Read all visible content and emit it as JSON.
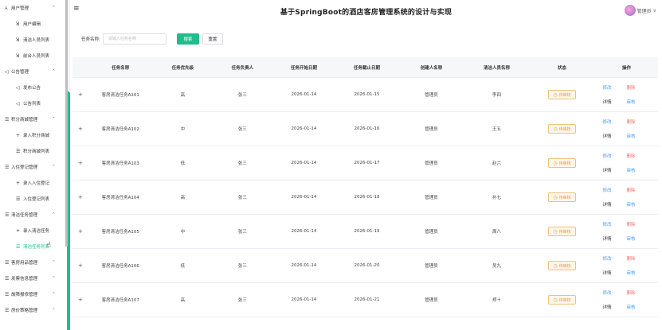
{
  "app": {
    "title": "基于SpringBoot的酒店客房管理系统的设计与实现",
    "user_name": "管理员"
  },
  "sidebar": {
    "groups": [
      {
        "label": "用户管理",
        "icon": "user-group-icon",
        "expanded": true,
        "items": [
          {
            "label": "用户编辑",
            "icon": "person-icon"
          },
          {
            "label": "清洁人员列表",
            "icon": "person-icon"
          },
          {
            "label": "前台人员列表",
            "icon": "person-icon"
          }
        ]
      },
      {
        "label": "公告管理",
        "icon": "speaker-icon",
        "expanded": true,
        "items": [
          {
            "label": "发布公告",
            "icon": "send-icon"
          },
          {
            "label": "公告列表",
            "icon": "speaker-icon"
          }
        ]
      },
      {
        "label": "积分商城管理",
        "icon": "list-icon",
        "expanded": true,
        "items": [
          {
            "label": "录入积分商城",
            "icon": "plus-icon"
          },
          {
            "label": "积分商城列表",
            "icon": "list-icon"
          }
        ]
      },
      {
        "label": "入住登记管理",
        "icon": "list-icon",
        "expanded": true,
        "items": [
          {
            "label": "录入入住登记",
            "icon": "plus-icon"
          },
          {
            "label": "入住登记列表",
            "icon": "list-icon"
          }
        ]
      },
      {
        "label": "清洁任务管理",
        "icon": "list-icon",
        "expanded": true,
        "items": [
          {
            "label": "录入清洁任务",
            "icon": "plus-icon"
          },
          {
            "label": "清洁任务列表",
            "icon": "list-icon",
            "active": true
          }
        ]
      },
      {
        "label": "客房用品管理",
        "icon": "list-icon",
        "expanded": false,
        "items": []
      },
      {
        "label": "发票信息管理",
        "icon": "list-icon",
        "expanded": false,
        "items": []
      },
      {
        "label": "故障报修管理",
        "icon": "list-icon",
        "expanded": false,
        "items": []
      },
      {
        "label": "房价策略管理",
        "icon": "list-icon",
        "expanded": false,
        "items": []
      }
    ]
  },
  "search": {
    "label": "任务名称:",
    "placeholder": "请输入任务名称",
    "search_button": "搜索",
    "reset_button": "重置"
  },
  "table": {
    "columns": [
      "任务名称",
      "任务优先级",
      "任务负责人",
      "任务开始日期",
      "任务截止日期",
      "创建人名称",
      "清洁人员名称",
      "状态",
      "操作"
    ],
    "rows": [
      {
        "name": "客房清洁任务A101",
        "priority": "高",
        "owner": "张三",
        "start": "2026-01-14",
        "end": "2026-01-15",
        "creator": "管理员",
        "cleaner": "李四",
        "status": "待审核"
      },
      {
        "name": "客房清洁任务A102",
        "priority": "中",
        "owner": "张三",
        "start": "2026-01-14",
        "end": "2026-01-16",
        "creator": "管理员",
        "cleaner": "王五",
        "status": "待审核"
      },
      {
        "name": "客房清洁任务A103",
        "priority": "低",
        "owner": "张三",
        "start": "2026-01-14",
        "end": "2026-01-17",
        "creator": "管理员",
        "cleaner": "赵六",
        "status": "待审核"
      },
      {
        "name": "客房清洁任务A104",
        "priority": "高",
        "owner": "张三",
        "start": "2026-01-14",
        "end": "2026-01-18",
        "creator": "管理员",
        "cleaner": "孙七",
        "status": "待审核"
      },
      {
        "name": "客房清洁任务A105",
        "priority": "中",
        "owner": "张三",
        "start": "2026-01-14",
        "end": "2026-01-19",
        "creator": "管理员",
        "cleaner": "周八",
        "status": "待审核"
      },
      {
        "name": "客房清洁任务A106",
        "priority": "低",
        "owner": "张三",
        "start": "2026-01-14",
        "end": "2026-01-20",
        "creator": "管理员",
        "cleaner": "吴九",
        "status": "待审核"
      },
      {
        "name": "客房清洁任务A107",
        "priority": "高",
        "owner": "张三",
        "start": "2026-01-14",
        "end": "2026-01-21",
        "creator": "管理员",
        "cleaner": "郑十",
        "status": "待审核"
      }
    ],
    "ops": {
      "edit": "修改",
      "delete": "删除",
      "detail": "详情",
      "review": "审核"
    }
  },
  "colors": {
    "accent": "#1fbd8c",
    "warning": "#e6a23c",
    "link": "#409eff",
    "danger": "#f56c6c"
  }
}
